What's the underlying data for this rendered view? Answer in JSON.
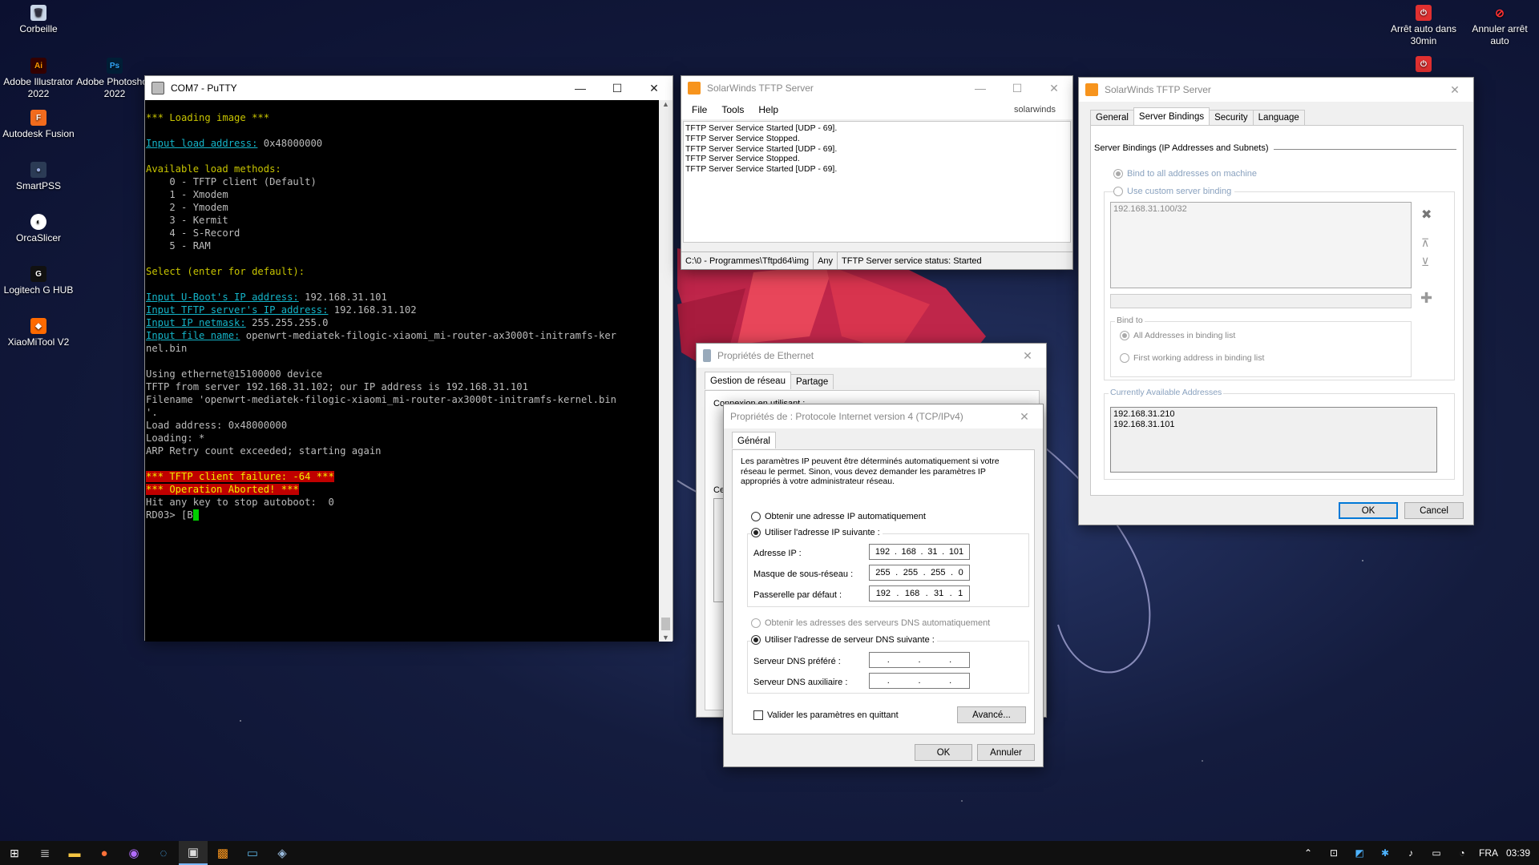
{
  "desktop_icons": [
    {
      "label": "Corbeille"
    },
    {
      "label": "Adobe Illustrator 2022",
      "glyph": "Ai"
    },
    {
      "label": "Adobe Photoshop 2022",
      "glyph": "Ps"
    },
    {
      "label": "Autodesk Fusion",
      "glyph": "F"
    },
    {
      "label": "SmartPSS"
    },
    {
      "label": "OrcaSlicer"
    },
    {
      "label": "Logitech G HUB",
      "glyph": "G"
    },
    {
      "label": "XiaoMiTool V2"
    },
    {
      "label": "Arrêt auto dans 30min"
    },
    {
      "label": "Annuler arrêt auto"
    }
  ],
  "putty": {
    "title": "COM7 - PuTTY",
    "lines": {
      "l1": "*** Loading image ***",
      "l2a": "Input load address:",
      "l2b": " 0x48000000",
      "l3": "Available load methods:",
      "m0": "    0 - TFTP client (Default)",
      "m1": "    1 - Xmodem",
      "m2": "    2 - Ymodem",
      "m3": "    3 - Kermit",
      "m4": "    4 - S-Record",
      "m5": "    5 - RAM",
      "l4": "Select (enter for default):",
      "ip1a": "Input U-Boot's IP address:",
      "ip1b": " 192.168.31.101",
      "ip2a": "Input TFTP server's IP address:",
      "ip2b": " 192.168.31.102",
      "ip3a": "Input IP netmask:",
      "ip3b": " 255.255.255.0",
      "fna": "Input file name:",
      "fnb": " openwrt-mediatek-filogic-xiaomi_mi-router-ax3000t-initramfs-ker",
      "fnc": "nel.bin",
      "u1": "Using ethernet@15100000 device",
      "u2": "TFTP from server 192.168.31.102; our IP address is 192.168.31.101",
      "u3": "Filename 'openwrt-mediatek-filogic-xiaomi_mi-router-ax3000t-initramfs-kernel.bin",
      "u4": "'.",
      "u5": "Load address: 0x48000000",
      "u6": "Loading: *",
      "u7": "ARP Retry count exceeded; starting again",
      "e1": "*** TFTP client failure: -64 ***",
      "e2": "*** Operation Aborted! ***",
      "h1": "Hit any key to stop autoboot:  0",
      "p1": "RD03> [B"
    }
  },
  "tftp_main": {
    "title": "SolarWinds TFTP Server",
    "menu": [
      "File",
      "Tools",
      "Help"
    ],
    "brand": "solarwinds",
    "log": [
      "TFTP Server Service Started [UDP - 69].",
      "TFTP Server Service Stopped.",
      "TFTP Server Service Started [UDP - 69].",
      "TFTP Server Service Stopped.",
      "TFTP Server Service Started [UDP - 69]."
    ],
    "status": {
      "path": "C:\\0 - Programmes\\Tftpd64\\img",
      "binding": "Any",
      "state": "TFTP Server service status: Started"
    }
  },
  "tftp_settings": {
    "title": "SolarWinds TFTP Server",
    "tabs": [
      "General",
      "Server Bindings",
      "Security",
      "Language"
    ],
    "section_title": "Server Bindings (IP Addresses and Subnets)",
    "bind_all": "Bind to all addresses on machine",
    "custom_binding": "Use custom server binding",
    "binding_list": [
      "192.168.31.100/32"
    ],
    "bind_to_label": "Bind to",
    "bind_all_list": "All Addresses in binding list",
    "bind_first": "First working address in binding list",
    "available_label": "Currently Available Addresses",
    "available": [
      "192.168.31.210",
      "192.168.31.101"
    ],
    "ok": "OK",
    "cancel": "Cancel"
  },
  "eth_props": {
    "title": "Propriétés de Ethernet",
    "tabs": [
      "Gestion de réseau",
      "Partage"
    ],
    "connect_label": "Connexion en utilisant :",
    "section_fragment": "Ce"
  },
  "ipv4": {
    "title": "Propriétés de : Protocole Internet version 4 (TCP/IPv4)",
    "tab": "Général",
    "intro": "Les paramètres IP peuvent être déterminés automatiquement si votre réseau le permet. Sinon, vous devez demander les paramètres IP appropriés à votre administrateur réseau.",
    "auto_ip": "Obtenir une adresse IP automatiquement",
    "manual_ip": "Utiliser l'adresse IP suivante :",
    "ip_label": "Adresse IP :",
    "ip": [
      "192",
      "168",
      "31",
      "101"
    ],
    "mask_label": "Masque de sous-réseau :",
    "mask": [
      "255",
      "255",
      "255",
      "0"
    ],
    "gw_label": "Passerelle par défaut :",
    "gw": [
      "192",
      "168",
      "31",
      "1"
    ],
    "auto_dns": "Obtenir les adresses des serveurs DNS automatiquement",
    "manual_dns": "Utiliser l'adresse de serveur DNS suivante :",
    "dns1_label": "Serveur DNS préféré :",
    "dns2_label": "Serveur DNS auxiliaire :",
    "validate": "Valider les paramètres en quittant",
    "advanced": "Avancé...",
    "ok": "OK",
    "cancel": "Annuler"
  },
  "taskbar": {
    "lang": "FRA",
    "time": "03:39"
  },
  "colors": {
    "terminal_bg": "#000000",
    "accent": "#0078d7",
    "error_bg": "#c00000"
  }
}
